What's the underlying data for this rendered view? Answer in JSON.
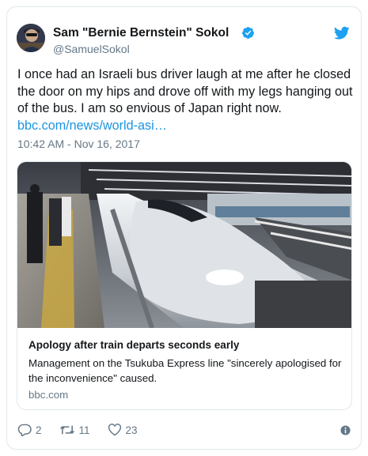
{
  "tweet": {
    "author_name": "Sam \"Bernie Bernstein\" Sokol",
    "author_handle": "@SamuelSokol",
    "text": "I once had an Israeli bus driver laugh at me after he closed the door on my hips and drove off with my legs hanging out of the bus. I am so envious of Japan right now.",
    "link_text": "bbc.com/news/world-asi…",
    "timestamp": "10:42 AM - Nov 16, 2017"
  },
  "card": {
    "title": "Apology after train departs seconds early",
    "description": "Management on the Tsukuba Express line \"sincerely apologised for the inconvenience\" caused.",
    "domain": "bbc.com"
  },
  "actions": {
    "replies": "2",
    "retweets": "11",
    "likes": "23"
  },
  "colors": {
    "link": "#1b95e0",
    "verified": "#1da1f2",
    "muted": "#657786"
  },
  "icons": [
    "verified-badge-icon",
    "twitter-bird-icon",
    "reply-icon",
    "retweet-icon",
    "like-icon",
    "info-icon"
  ]
}
